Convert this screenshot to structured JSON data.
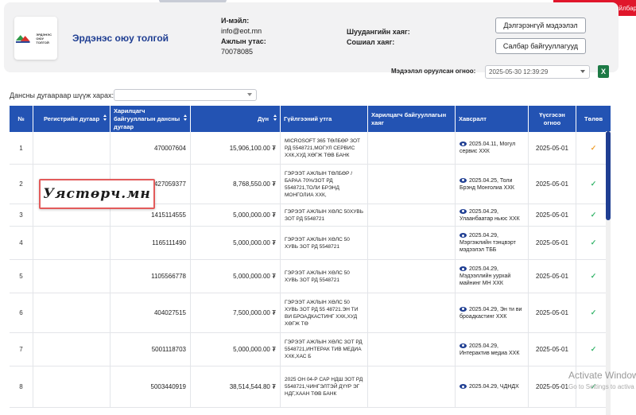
{
  "alert": {
    "label": "Нэр томьёоны тайлбар"
  },
  "company": {
    "name": "Эрдэнэс оюу толгой",
    "logo_text_line1": "ЭРДЭНЭС",
    "logo_text_line2": "ОЮУ ТОЛГОЙ"
  },
  "contact": {
    "email_label": "И-мэйл:",
    "email_value": "info@eot.mn",
    "phone_label": "Ажлын утас:",
    "phone_value": "70078085",
    "court_label": "Шуудангийн хаяг:",
    "social_label": "Сошиал хаяг:"
  },
  "buttons": {
    "details": "Дэлгэрэнгүй мэдээлэл",
    "branches": "Салбар байгууллагууд"
  },
  "date": {
    "label": "Мэдээлэл оруулсан огноо:",
    "value": "2025-05-30 12:39:29"
  },
  "filter": {
    "label": "Дансны дугаараар шүүж харах:"
  },
  "table": {
    "headers": {
      "no": "№",
      "reg": "Регистрийн дугаар",
      "account": "Харилцагч байгууллагын дансны дугаар",
      "amount": "Дүн",
      "purpose": "Гүйлгээний утга",
      "address": "Харилцагч байгууллагын хаяг",
      "attachment": "Хавсралт",
      "created": "Үүсгэсэн огноо",
      "paid": "Төлөв"
    },
    "rows": [
      {
        "no": "1",
        "account": "470007604",
        "amount": "15,906,100.00 ₮",
        "purpose": "MICROSOFT 365 ТӨЛБӨР ЗОТ РД 5548721,МОГУЛ СЕРВИС ХХК,ХУД ХӨГЖ ТӨВ БАНК",
        "attachment": "2025.04.11, Могул сервис ХХК",
        "created": "2025-05-01",
        "status": "orange"
      },
      {
        "no": "2",
        "account": "427059377",
        "amount": "8,768,550.00 ₮",
        "purpose": "ГЭРЭЭТ АЖЛЫН ТӨЛБӨР / БАРАА 70%/ЗОТ РД 5548721,ТОЛИ БРЭНД МОНГОЛИА ХХК,",
        "attachment": "2025.04.25, Толи Брэнд Монголиа ХХК",
        "created": "2025-05-01",
        "status": "green"
      },
      {
        "no": "3",
        "account": "1415114555",
        "amount": "5,000,000.00 ₮",
        "purpose": "ГЭРЭЭТ АЖЛЫН ХӨЛС 50ХУВЬ ЗОТ РД 5548721",
        "attachment": "2025.04.29, Улаанбаатар ньюс ХХК",
        "created": "2025-05-01",
        "status": "green"
      },
      {
        "no": "4",
        "account": "1165111490",
        "amount": "5,000,000.00 ₮",
        "purpose": "ГЭРЭЭТ АЖЛЫН ХӨЛС 50 ХУВЬ ЗОТ РД 5548721",
        "attachment": "2025.04.29, Мэргэжлийн тэнцвэрт мэдээлэл ТББ",
        "created": "2025-05-01",
        "status": "green"
      },
      {
        "no": "5",
        "account": "1105566778",
        "amount": "5,000,000.00 ₮",
        "purpose": "ГЭРЭЭТ АЖЛЫН ХӨЛС 50 ХУВЬ ЗОТ РД 5548721",
        "attachment": "2025.04.29, Мэдээллийн уурхай майнинг МН ХХК",
        "created": "2025-05-01",
        "status": "green"
      },
      {
        "no": "6",
        "account": "404027515",
        "amount": "7,500,000.00 ₮",
        "purpose": "ГЭРЭЭТ АЖЛЫН ХӨЛС 50 ХУВЬ ЗОТ РД 55 48721.ЭН ТИ ВИ БРОАДКАСТИНГ ХХК,ХУД ХӨГЖ ТӨ",
        "attachment": "2025.04.29, Эн ти ви броадкастинг ХХК",
        "created": "2025-05-01",
        "status": "green"
      },
      {
        "no": "7",
        "account": "5001118703",
        "amount": "5,000,000.00 ₮",
        "purpose": "гэрээт ажлын хөлс ЗОТ рд 5548721,ИНТЕРАК ТИВ МЕДИА ХХК,ХАС Б",
        "attachment": "2025.04.29, Интерактив медиа ХХК",
        "created": "2025-05-01",
        "status": "green"
      },
      {
        "no": "8",
        "account": "5003440919",
        "amount": "38,514,544.80 ₮",
        "purpose": "2025 ОН 04-Р САР НДШ ЗОТ РД 5548721,ЧИНГЭЛТЭЙ ДҮҮР ЭГ НДГ,ХААН ТӨВ БАНК",
        "attachment": "2025.04.29, ЧДНДХ",
        "created": "2025-05-01",
        "status": "green"
      }
    ]
  },
  "stamp": {
    "text": "Уястөрч.мн"
  },
  "os_overlay": {
    "title": "Activate Window",
    "subtitle": "Go to Settings to activa"
  },
  "colors": {
    "header_blue": "#2353b3",
    "brand_blue": "#1f3e92",
    "alert_red": "#e0162b",
    "check_green": "#37b56c",
    "check_orange": "#f0a030"
  }
}
